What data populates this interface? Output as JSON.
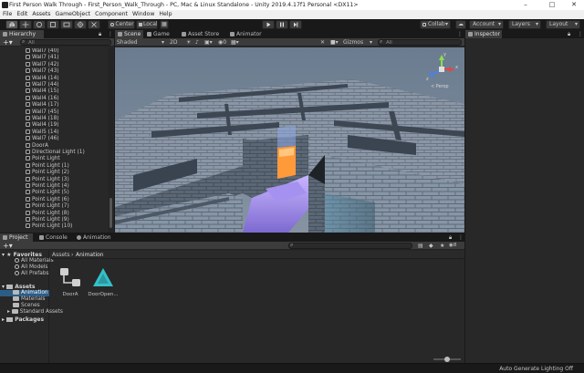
{
  "window": {
    "title": "First Person Walk Through - First_Person_Walk_Through - PC, Mac & Linux Standalone - Unity 2019.4.17f1 Personal <DX11>",
    "minimize": "–",
    "maximize": "□",
    "close": "✕"
  },
  "menu": [
    "File",
    "Edit",
    "Assets",
    "GameObject",
    "Component",
    "Window",
    "Help"
  ],
  "toolbar": {
    "pivot_center": "Center",
    "pivot_space": "Local",
    "collab": "Collab",
    "account": "Account",
    "layers": "Layers",
    "layout": "Layout"
  },
  "hierarchy": {
    "tab": "Hierarchy",
    "search_placeholder": "All",
    "items": [
      "Wall7 (40)",
      "Wall7 (41)",
      "Wall7 (42)",
      "Wall7 (43)",
      "Wall4 (14)",
      "Wall7 (44)",
      "Wall4 (15)",
      "Wall4 (16)",
      "Wall4 (17)",
      "Wall7 (45)",
      "Wall4 (18)",
      "Wall4 (19)",
      "Wall5 (14)",
      "Wall7 (46)",
      "DoorA",
      "Directional Light (1)",
      "Point Light",
      "Point Light (1)",
      "Point Light (2)",
      "Point Light (3)",
      "Point Light (4)",
      "Point Light (5)",
      "Point Light (6)",
      "Point Light (7)",
      "Point Light (8)",
      "Point Light (9)",
      "Point Light (10)"
    ]
  },
  "scene_view": {
    "tabs": [
      "Scene",
      "Game",
      "Asset Store",
      "Animator"
    ],
    "shading": "Shaded",
    "mode_2d": "2D",
    "gizmos": "Gizmos",
    "search_placeholder": "All",
    "gizmo_label": "< Persp",
    "gizmo_axes": [
      "y",
      "x",
      "z"
    ]
  },
  "inspector": {
    "tab": "Inspector"
  },
  "project": {
    "tabs": [
      "Project",
      "Console",
      "Animation"
    ],
    "breadcrumb": [
      "Assets",
      "Animation"
    ],
    "favorites_title": "Favorites",
    "favorites": [
      "All Materials",
      "All Models",
      "All Prefabs"
    ],
    "assets_title": "Assets",
    "folders": [
      "Animation",
      "Materials",
      "Scenes",
      "Standard Assets"
    ],
    "packages_title": "Packages",
    "hidden_count": "8",
    "assets": [
      {
        "name": "DoorA",
        "kind": "animator-controller"
      },
      {
        "name": "DoorOpen...",
        "kind": "animation-clip"
      }
    ]
  },
  "status_bar": {
    "text": "Auto Generate Lighting Off"
  },
  "colors": {
    "background": "#191919",
    "panel": "#282828",
    "header": "#3c3c3c",
    "selection": "#2c5d87",
    "clip_teal": "#35c0c8"
  }
}
